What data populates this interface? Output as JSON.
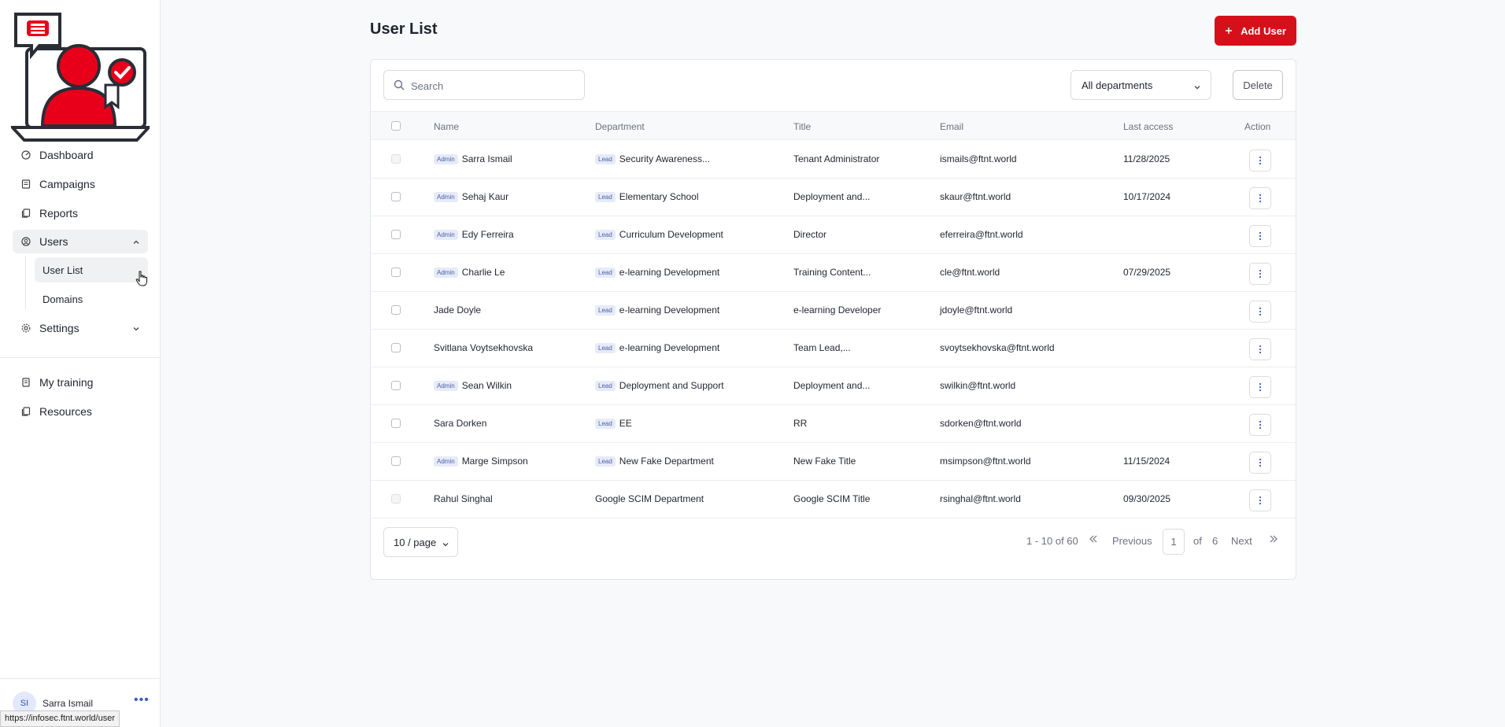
{
  "sidebar": {
    "nav": [
      {
        "label": "Dashboard",
        "icon": "dashboard-icon"
      },
      {
        "label": "Campaigns",
        "icon": "campaigns-icon"
      },
      {
        "label": "Reports",
        "icon": "reports-icon"
      },
      {
        "label": "Users",
        "icon": "users-icon"
      }
    ],
    "users_sub": [
      {
        "label": "User List"
      },
      {
        "label": "Domains"
      }
    ],
    "settings": {
      "label": "Settings",
      "icon": "settings-icon"
    },
    "secondary": [
      {
        "label": "My training",
        "icon": "training-icon"
      },
      {
        "label": "Resources",
        "icon": "resources-icon"
      }
    ],
    "user": {
      "initials": "SI",
      "name": "Sarra Ismail"
    },
    "status_url": "https://infosec.ftnt.world/user"
  },
  "header": {
    "title": "User List",
    "add_button": "Add User",
    "brand_color": "#d5101b"
  },
  "toolbar": {
    "search_placeholder": "Search",
    "department_filter": "All departments",
    "delete_button": "Delete"
  },
  "table": {
    "columns": [
      "Name",
      "Department",
      "Title",
      "Email",
      "Last access",
      "Action"
    ],
    "rows": [
      {
        "admin": "Admin",
        "name": "Sarra Ismail",
        "lead": "Lead",
        "department": "Security Awareness...",
        "title": "Tenant Administrator",
        "email": "ismails@ftnt.world",
        "last_access": "11/28/2025",
        "disabled": true
      },
      {
        "admin": "Admin",
        "name": "Sehaj Kaur",
        "lead": "Lead",
        "department": "Elementary School",
        "title": "Deployment and...",
        "email": "skaur@ftnt.world",
        "last_access": "10/17/2024",
        "disabled": false
      },
      {
        "admin": "Admin",
        "name": "Edy Ferreira",
        "lead": "Lead",
        "department": "Curriculum Development",
        "title": "Director",
        "email": "eferreira@ftnt.world",
        "last_access": "",
        "disabled": false
      },
      {
        "admin": "Admin",
        "name": "Charlie Le",
        "lead": "Lead",
        "department": "e-learning Development",
        "title": "Training Content...",
        "email": "cle@ftnt.world",
        "last_access": "07/29/2025",
        "disabled": false
      },
      {
        "admin": "",
        "name": "Jade Doyle",
        "lead": "Lead",
        "department": "e-learning Development",
        "title": "e-learning Developer",
        "email": "jdoyle@ftnt.world",
        "last_access": "",
        "disabled": false
      },
      {
        "admin": "",
        "name": "Svitlana Voytsekhovska",
        "lead": "Lead",
        "department": "e-learning Development",
        "title": "Team Lead,...",
        "email": "svoytsekhovska@ftnt.world",
        "last_access": "",
        "disabled": false
      },
      {
        "admin": "Admin",
        "name": "Sean Wilkin",
        "lead": "Lead",
        "department": "Deployment and Support",
        "title": "Deployment and...",
        "email": "swilkin@ftnt.world",
        "last_access": "",
        "disabled": false
      },
      {
        "admin": "",
        "name": "Sara Dorken",
        "lead": "Lead",
        "department": "EE",
        "title": "RR",
        "email": "sdorken@ftnt.world",
        "last_access": "",
        "disabled": false
      },
      {
        "admin": "Admin",
        "name": "Marge Simpson",
        "lead": "Lead",
        "department": "New Fake Department",
        "title": "New Fake Title",
        "email": "msimpson@ftnt.world",
        "last_access": "11/15/2024",
        "disabled": false
      },
      {
        "admin": "",
        "name": "Rahul Singhal",
        "lead": "",
        "department": "Google SCIM Department",
        "title": "Google SCIM Title",
        "email": "rsinghal@ftnt.world",
        "last_access": "09/30/2025",
        "disabled": true
      }
    ]
  },
  "pagination": {
    "page_size": "10 / page",
    "range": "1 - 10 of 60",
    "previous": "Previous",
    "current_page": "1",
    "of_label": "of",
    "total_pages": "6",
    "next": "Next"
  }
}
